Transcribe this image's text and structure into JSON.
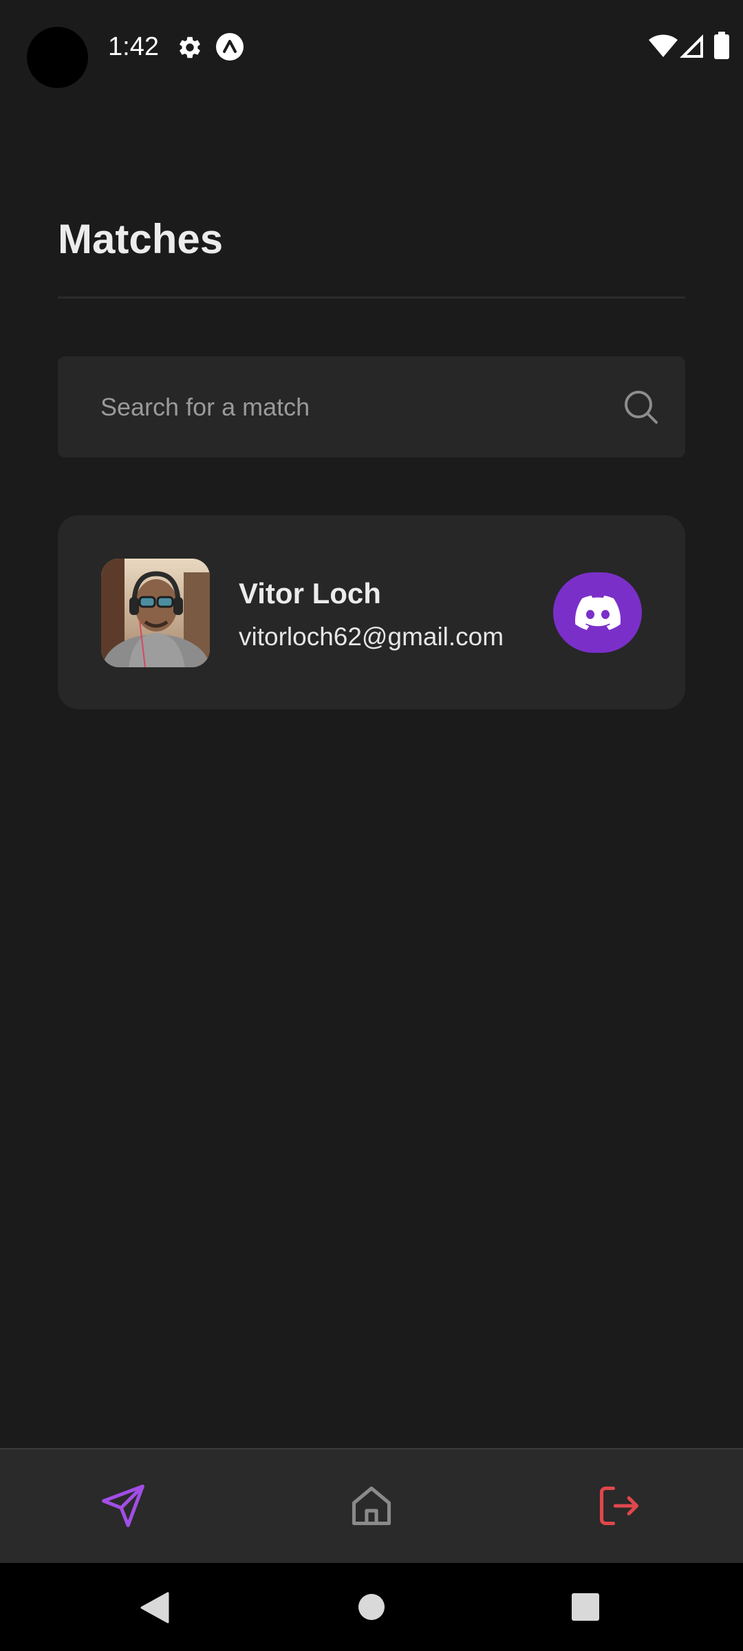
{
  "status_bar": {
    "time": "1:42",
    "icons": [
      "gear-icon",
      "expo-icon",
      "wifi-icon",
      "cell-signal-icon",
      "battery-icon"
    ]
  },
  "header": {
    "title": "Matches"
  },
  "search": {
    "placeholder": "Search for a match",
    "value": "",
    "icon": "search-icon"
  },
  "matches": [
    {
      "name": "Vitor Loch",
      "email": "vitorloch62@gmail.com",
      "action_icon": "discord-icon",
      "action_color": "#7b2fc9"
    }
  ],
  "bottom_nav": {
    "items": [
      {
        "icon": "send-icon",
        "color": "#a24ee6",
        "active": true
      },
      {
        "icon": "home-icon",
        "color": "#8a8a8a",
        "active": false
      },
      {
        "icon": "logout-icon",
        "color": "#e0474c",
        "active": false
      }
    ]
  },
  "system_nav": {
    "buttons": [
      "back-icon",
      "home-circle-icon",
      "recents-icon"
    ]
  },
  "colors": {
    "background": "#1b1b1b",
    "surface": "#272727",
    "accent": "#7b2fc9",
    "danger": "#e0474c"
  }
}
